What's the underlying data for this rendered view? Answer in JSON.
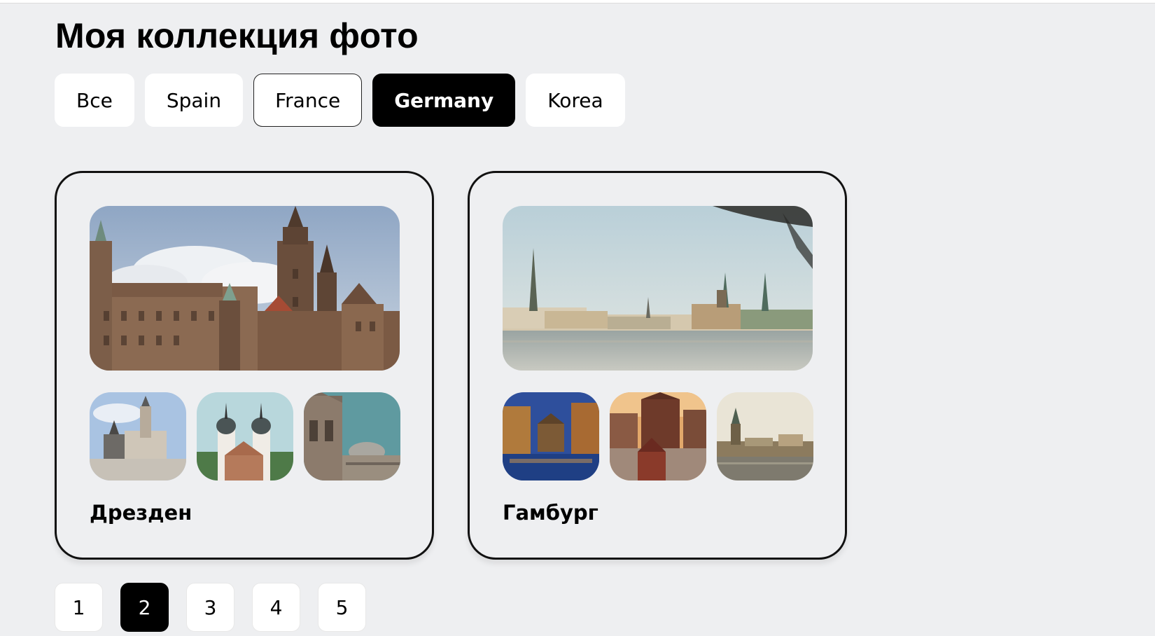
{
  "page": {
    "title": "Моя коллекция фото"
  },
  "filters": [
    {
      "label": "Все",
      "state": "default"
    },
    {
      "label": "Spain",
      "state": "default"
    },
    {
      "label": "France",
      "state": "outlined"
    },
    {
      "label": "Germany",
      "state": "active"
    },
    {
      "label": "Korea",
      "state": "default"
    }
  ],
  "cards": [
    {
      "city": "Дрезден",
      "main_photo": "dresden-cathedral-skyline-photo",
      "thumbnails": [
        "dresden-square-photo",
        "old-gate-towers-photo",
        "zwinger-palace-photo"
      ]
    },
    {
      "city": "Гамбург",
      "main_photo": "hamburg-alster-lake-skyline-photo",
      "thumbnails": [
        "speicherstadt-night-canal-photo",
        "brick-warehouse-sunset-photo",
        "hamburg-city-hall-photo"
      ]
    }
  ],
  "pagination": {
    "pages": [
      "1",
      "2",
      "3",
      "4",
      "5"
    ],
    "current": "2"
  },
  "colors": {
    "background": "#eeeff1",
    "active": "#000000",
    "button": "#ffffff",
    "card_border": "#111111"
  }
}
